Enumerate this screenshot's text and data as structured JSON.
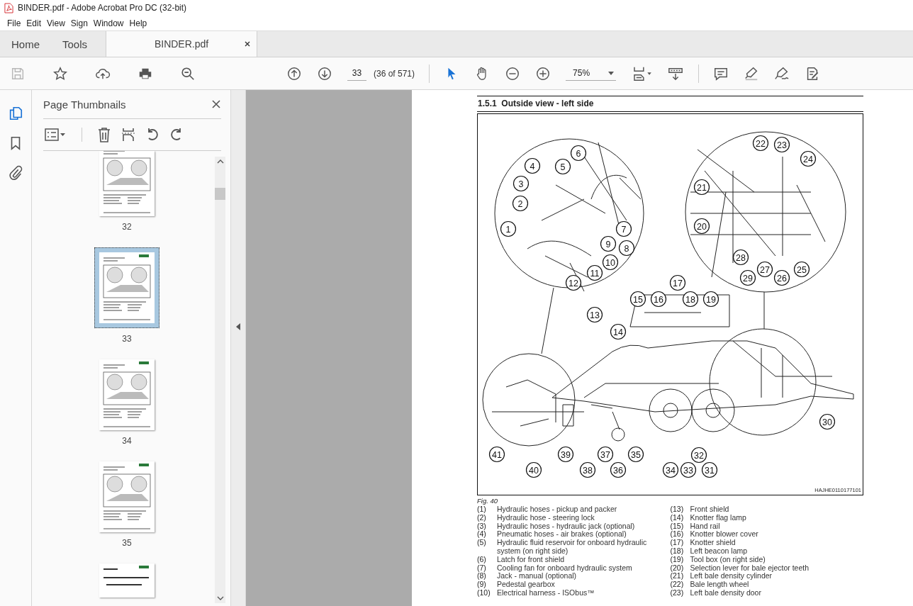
{
  "title_bar": {
    "title": "BINDER.pdf - Adobe Acrobat Pro DC (32-bit)"
  },
  "menu": [
    "File",
    "Edit",
    "View",
    "Sign",
    "Window",
    "Help"
  ],
  "tabs": [
    {
      "label": "Home",
      "selected": false
    },
    {
      "label": "Tools",
      "selected": false
    },
    {
      "label": "BINDER.pdf",
      "selected": true
    }
  ],
  "toolbar": {
    "page_number": "33",
    "page_info": "(36 of 571)",
    "zoom": "75%"
  },
  "sidebar": {
    "title": "Page Thumbnails",
    "thumbnails": [
      {
        "label": "32",
        "selected": false
      },
      {
        "label": "33",
        "selected": true
      },
      {
        "label": "34",
        "selected": false
      },
      {
        "label": "35",
        "selected": false
      }
    ]
  },
  "document": {
    "section_number": "1.5.1",
    "section_title": "Outside view - left side",
    "figure": {
      "callouts": [
        "1",
        "2",
        "3",
        "4",
        "5",
        "6",
        "7",
        "8",
        "9",
        "10",
        "11",
        "12",
        "13",
        "14",
        "15",
        "16",
        "17",
        "18",
        "19",
        "21",
        "20",
        "22",
        "23",
        "24",
        "25",
        "26",
        "27",
        "28",
        "29",
        "30",
        "41",
        "39",
        "37",
        "35",
        "32",
        "40",
        "38",
        "36",
        "34",
        "33",
        "31"
      ],
      "code": "HAJHE0110177101",
      "caption": "Fig. 40"
    },
    "legend_columns": [
      [
        {
          "num": "(1)",
          "text": "Hydraulic hoses - pickup and packer"
        },
        {
          "num": "(2)",
          "text": "Hydraulic hose - steering lock"
        },
        {
          "num": "(3)",
          "text": "Hydraulic hoses - hydraulic jack (optional)"
        },
        {
          "num": "(4)",
          "text": "Pneumatic hoses - air brakes (optional)"
        },
        {
          "num": "(5)",
          "text": "Hydraulic fluid reservoir for onboard hydraulic system (on right side)"
        },
        {
          "num": "(6)",
          "text": "Latch for front shield"
        },
        {
          "num": "(7)",
          "text": "Cooling fan for onboard hydraulic system"
        },
        {
          "num": "(8)",
          "text": "Jack - manual (optional)"
        },
        {
          "num": "(9)",
          "text": "Pedestal gearbox"
        },
        {
          "num": "(10)",
          "text": "Electrical harness - ISObus™"
        }
      ],
      [
        {
          "num": "(13)",
          "text": "Front shield"
        },
        {
          "num": "(14)",
          "text": "Knotter flag lamp"
        },
        {
          "num": "(15)",
          "text": "Hand rail"
        },
        {
          "num": "(16)",
          "text": "Knotter blower cover"
        },
        {
          "num": "(17)",
          "text": "Knotter shield"
        },
        {
          "num": "(18)",
          "text": "Left beacon lamp"
        },
        {
          "num": "(19)",
          "text": "Tool box (on right side)"
        },
        {
          "num": "(20)",
          "text": "Selection lever for bale ejector teeth"
        },
        {
          "num": "(21)",
          "text": "Left bale density cylinder"
        },
        {
          "num": "(22)",
          "text": "Bale length wheel"
        },
        {
          "num": "(23)",
          "text": "Left bale density door"
        }
      ]
    ]
  }
}
